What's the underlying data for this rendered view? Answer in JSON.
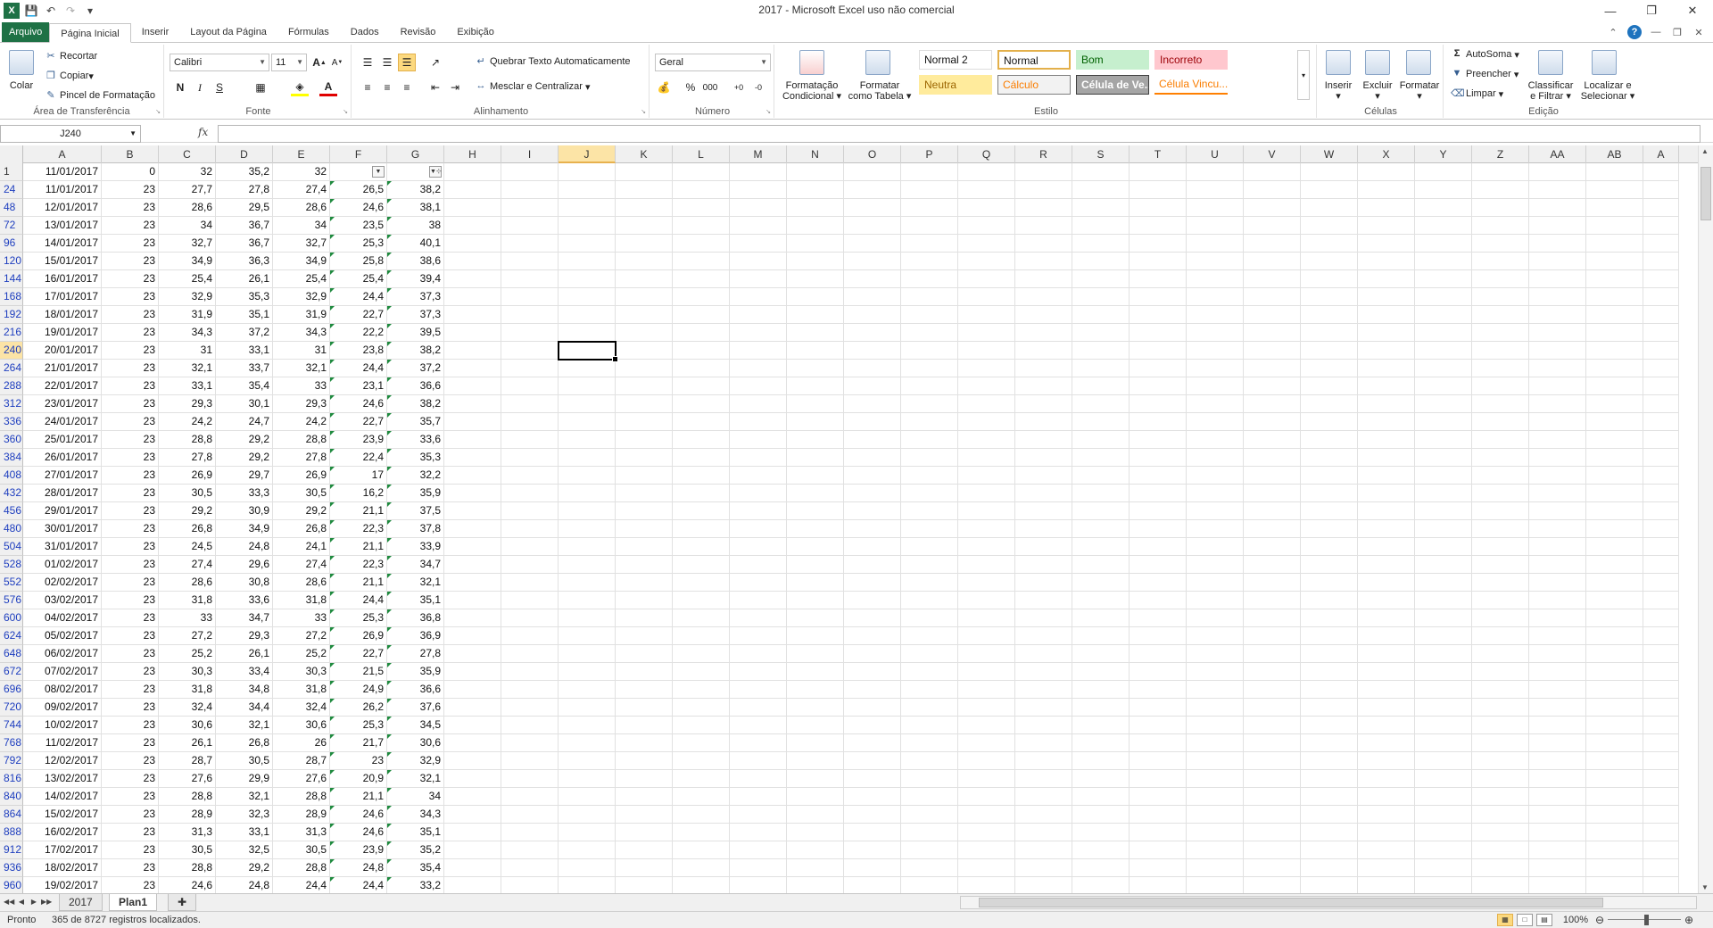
{
  "window": {
    "title": "2017  -  Microsoft Excel uso não comercial",
    "app_icon": "X"
  },
  "ribbon": {
    "tabs": [
      {
        "label": "Arquivo",
        "kind": "file"
      },
      {
        "label": "Página Inicial",
        "kind": "active"
      },
      {
        "label": "Inserir"
      },
      {
        "label": "Layout da Página"
      },
      {
        "label": "Fórmulas"
      },
      {
        "label": "Dados"
      },
      {
        "label": "Revisão"
      },
      {
        "label": "Exibição"
      }
    ],
    "clipboard": {
      "paste": "Colar",
      "cut": "Recortar",
      "copy": "Copiar",
      "painter": "Pincel de Formatação",
      "label": "Área de Transferência"
    },
    "font": {
      "name": "Calibri",
      "size": "11",
      "bold": "N",
      "italic": "I",
      "underline": "S",
      "label": "Fonte"
    },
    "alignment": {
      "wrap": "Quebrar Texto Automaticamente",
      "merge": "Mesclar e Centralizar",
      "label": "Alinhamento"
    },
    "number": {
      "format": "Geral",
      "percent": "%",
      "thousands": "000",
      "label": "Número"
    },
    "styles": {
      "cond_format_1": "Formatação",
      "cond_format_2": "Condicional",
      "table_format_1": "Formatar",
      "table_format_2": "como Tabela",
      "cells": [
        {
          "label": "Normal 2",
          "bg": "#ffffff",
          "fg": "#111111",
          "border": "#dddddd"
        },
        {
          "label": "Normal",
          "bg": "#ffffff",
          "fg": "#111111",
          "border": "#e3b04b"
        },
        {
          "label": "Bom",
          "bg": "#c6efce",
          "fg": "#006100",
          "border": "#c6efce"
        },
        {
          "label": "Incorreto",
          "bg": "#ffc7ce",
          "fg": "#9c0006",
          "border": "#ffc7ce"
        },
        {
          "label": "Neutra",
          "bg": "#ffeb9c",
          "fg": "#9c6500",
          "border": "#ffeb9c"
        },
        {
          "label": "Cálculo",
          "bg": "#f2f2f2",
          "fg": "#fa7d00",
          "border": "#7f7f7f"
        },
        {
          "label": "Célula de Ve...",
          "bg": "#a5a5a5",
          "fg": "#ffffff",
          "border": "#3f3f3f"
        },
        {
          "label": "Célula Vincu...",
          "bg": "#ffffff",
          "fg": "#fa7d00",
          "border": "#ff8001"
        }
      ],
      "label": "Estilo"
    },
    "cells_group": {
      "insert": "Inserir",
      "delete": "Excluir",
      "format": "Formatar",
      "label": "Células"
    },
    "editing": {
      "autosum": "AutoSoma",
      "fill": "Preencher",
      "clear": "Limpar",
      "sort_1": "Classificar",
      "sort_2": "e Filtrar",
      "find_1": "Localizar e",
      "find_2": "Selecionar",
      "label": "Edição"
    }
  },
  "formula_bar": {
    "name_box": "J240",
    "fx": "fx",
    "value": ""
  },
  "grid": {
    "columns": [
      "A",
      "B",
      "C",
      "D",
      "E",
      "F",
      "G",
      "H",
      "I",
      "J",
      "K",
      "L",
      "M",
      "N",
      "O",
      "P",
      "Q",
      "R",
      "S",
      "T",
      "U",
      "V",
      "W",
      "X",
      "Y",
      "Z",
      "AA",
      "AB",
      "A"
    ],
    "selected_column": "J",
    "selected_row": "240",
    "rows": [
      {
        "h": "1",
        "plain": true,
        "c": [
          "11/01/2017",
          "0",
          "32",
          "35,2",
          "32",
          "",
          ""
        ]
      },
      {
        "h": "24",
        "c": [
          "11/01/2017",
          "23",
          "27,7",
          "27,8",
          "27,4",
          "26,5",
          "38,2"
        ]
      },
      {
        "h": "48",
        "c": [
          "12/01/2017",
          "23",
          "28,6",
          "29,5",
          "28,6",
          "24,6",
          "38,1"
        ]
      },
      {
        "h": "72",
        "c": [
          "13/01/2017",
          "23",
          "34",
          "36,7",
          "34",
          "23,5",
          "38"
        ]
      },
      {
        "h": "96",
        "c": [
          "14/01/2017",
          "23",
          "32,7",
          "36,7",
          "32,7",
          "25,3",
          "40,1"
        ]
      },
      {
        "h": "120",
        "c": [
          "15/01/2017",
          "23",
          "34,9",
          "36,3",
          "34,9",
          "25,8",
          "38,6"
        ]
      },
      {
        "h": "144",
        "c": [
          "16/01/2017",
          "23",
          "25,4",
          "26,1",
          "25,4",
          "25,4",
          "39,4"
        ]
      },
      {
        "h": "168",
        "c": [
          "17/01/2017",
          "23",
          "32,9",
          "35,3",
          "32,9",
          "24,4",
          "37,3"
        ]
      },
      {
        "h": "192",
        "c": [
          "18/01/2017",
          "23",
          "31,9",
          "35,1",
          "31,9",
          "22,7",
          "37,3"
        ]
      },
      {
        "h": "216",
        "c": [
          "19/01/2017",
          "23",
          "34,3",
          "37,2",
          "34,3",
          "22,2",
          "39,5"
        ]
      },
      {
        "h": "240",
        "c": [
          "20/01/2017",
          "23",
          "31",
          "33,1",
          "31",
          "23,8",
          "38,2"
        ]
      },
      {
        "h": "264",
        "c": [
          "21/01/2017",
          "23",
          "32,1",
          "33,7",
          "32,1",
          "24,4",
          "37,2"
        ]
      },
      {
        "h": "288",
        "c": [
          "22/01/2017",
          "23",
          "33,1",
          "35,4",
          "33",
          "23,1",
          "36,6"
        ]
      },
      {
        "h": "312",
        "c": [
          "23/01/2017",
          "23",
          "29,3",
          "30,1",
          "29,3",
          "24,6",
          "38,2"
        ]
      },
      {
        "h": "336",
        "c": [
          "24/01/2017",
          "23",
          "24,2",
          "24,7",
          "24,2",
          "22,7",
          "35,7"
        ]
      },
      {
        "h": "360",
        "c": [
          "25/01/2017",
          "23",
          "28,8",
          "29,2",
          "28,8",
          "23,9",
          "33,6"
        ]
      },
      {
        "h": "384",
        "c": [
          "26/01/2017",
          "23",
          "27,8",
          "29,2",
          "27,8",
          "22,4",
          "35,3"
        ]
      },
      {
        "h": "408",
        "c": [
          "27/01/2017",
          "23",
          "26,9",
          "29,7",
          "26,9",
          "17",
          "32,2"
        ]
      },
      {
        "h": "432",
        "c": [
          "28/01/2017",
          "23",
          "30,5",
          "33,3",
          "30,5",
          "16,2",
          "35,9"
        ]
      },
      {
        "h": "456",
        "c": [
          "29/01/2017",
          "23",
          "29,2",
          "30,9",
          "29,2",
          "21,1",
          "37,5"
        ]
      },
      {
        "h": "480",
        "c": [
          "30/01/2017",
          "23",
          "26,8",
          "34,9",
          "26,8",
          "22,3",
          "37,8"
        ]
      },
      {
        "h": "504",
        "c": [
          "31/01/2017",
          "23",
          "24,5",
          "24,8",
          "24,1",
          "21,1",
          "33,9"
        ]
      },
      {
        "h": "528",
        "c": [
          "01/02/2017",
          "23",
          "27,4",
          "29,6",
          "27,4",
          "22,3",
          "34,7"
        ]
      },
      {
        "h": "552",
        "c": [
          "02/02/2017",
          "23",
          "28,6",
          "30,8",
          "28,6",
          "21,1",
          "32,1"
        ]
      },
      {
        "h": "576",
        "c": [
          "03/02/2017",
          "23",
          "31,8",
          "33,6",
          "31,8",
          "24,4",
          "35,1"
        ]
      },
      {
        "h": "600",
        "c": [
          "04/02/2017",
          "23",
          "33",
          "34,7",
          "33",
          "25,3",
          "36,8"
        ]
      },
      {
        "h": "624",
        "c": [
          "05/02/2017",
          "23",
          "27,2",
          "29,3",
          "27,2",
          "26,9",
          "36,9"
        ]
      },
      {
        "h": "648",
        "c": [
          "06/02/2017",
          "23",
          "25,2",
          "26,1",
          "25,2",
          "22,7",
          "27,8"
        ]
      },
      {
        "h": "672",
        "c": [
          "07/02/2017",
          "23",
          "30,3",
          "33,4",
          "30,3",
          "21,5",
          "35,9"
        ]
      },
      {
        "h": "696",
        "c": [
          "08/02/2017",
          "23",
          "31,8",
          "34,8",
          "31,8",
          "24,9",
          "36,6"
        ]
      },
      {
        "h": "720",
        "c": [
          "09/02/2017",
          "23",
          "32,4",
          "34,4",
          "32,4",
          "26,2",
          "37,6"
        ]
      },
      {
        "h": "744",
        "c": [
          "10/02/2017",
          "23",
          "30,6",
          "32,1",
          "30,6",
          "25,3",
          "34,5"
        ]
      },
      {
        "h": "768",
        "c": [
          "11/02/2017",
          "23",
          "26,1",
          "26,8",
          "26",
          "21,7",
          "30,6"
        ]
      },
      {
        "h": "792",
        "c": [
          "12/02/2017",
          "23",
          "28,7",
          "30,5",
          "28,7",
          "23",
          "32,9"
        ]
      },
      {
        "h": "816",
        "c": [
          "13/02/2017",
          "23",
          "27,6",
          "29,9",
          "27,6",
          "20,9",
          "32,1"
        ]
      },
      {
        "h": "840",
        "c": [
          "14/02/2017",
          "23",
          "28,8",
          "32,1",
          "28,8",
          "21,1",
          "34"
        ]
      },
      {
        "h": "864",
        "c": [
          "15/02/2017",
          "23",
          "28,9",
          "32,3",
          "28,9",
          "24,6",
          "34,3"
        ]
      },
      {
        "h": "888",
        "c": [
          "16/02/2017",
          "23",
          "31,3",
          "33,1",
          "31,3",
          "24,6",
          "35,1"
        ]
      },
      {
        "h": "912",
        "c": [
          "17/02/2017",
          "23",
          "30,5",
          "32,5",
          "30,5",
          "23,9",
          "35,2"
        ]
      },
      {
        "h": "936",
        "c": [
          "18/02/2017",
          "23",
          "28,8",
          "29,2",
          "28,8",
          "24,8",
          "35,4"
        ]
      },
      {
        "h": "960",
        "c": [
          "19/02/2017",
          "23",
          "24,6",
          "24,8",
          "24,4",
          "24,4",
          "33,2"
        ]
      }
    ]
  },
  "sheets": {
    "tabs": [
      "2017",
      "Plan1"
    ],
    "active": "Plan1"
  },
  "status": {
    "ready": "Pronto",
    "message": "365 de 8727 registros localizados.",
    "zoom": "100%"
  }
}
